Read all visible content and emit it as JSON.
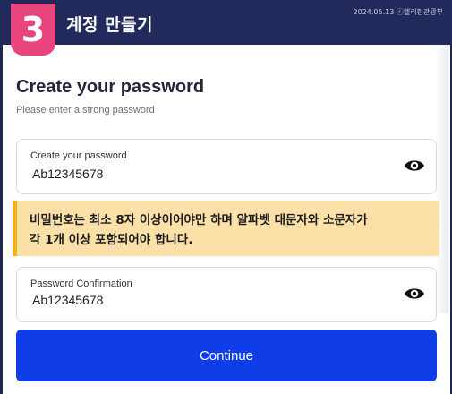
{
  "header": {
    "step": "3",
    "title": "계정 만들기",
    "meta": "2024.05.13 ⓒ헬리펀관광부"
  },
  "page": {
    "title": "Create your password",
    "subtitle": "Please enter a strong password"
  },
  "password_field": {
    "label": "Create your password",
    "value": "Ab12345678"
  },
  "notice": {
    "line1": "비밀번호는 최소 8자 이상이어야만 하며 알파벳 대문자와 소문자가",
    "line2": "각 1개 이상 포함되어야 합니다."
  },
  "confirm_field": {
    "label": "Password Confirmation",
    "value": "Ab12345678"
  },
  "continue_button": {
    "label": "Continue"
  },
  "colors": {
    "header_bg": "#222a5c",
    "step_badge": "#e8457e",
    "notice_bg": "#fbe0a8",
    "notice_border": "#f2b01e",
    "primary_button": "#0f3ee8"
  },
  "icons": {
    "visibility_toggle": "eye-icon"
  }
}
